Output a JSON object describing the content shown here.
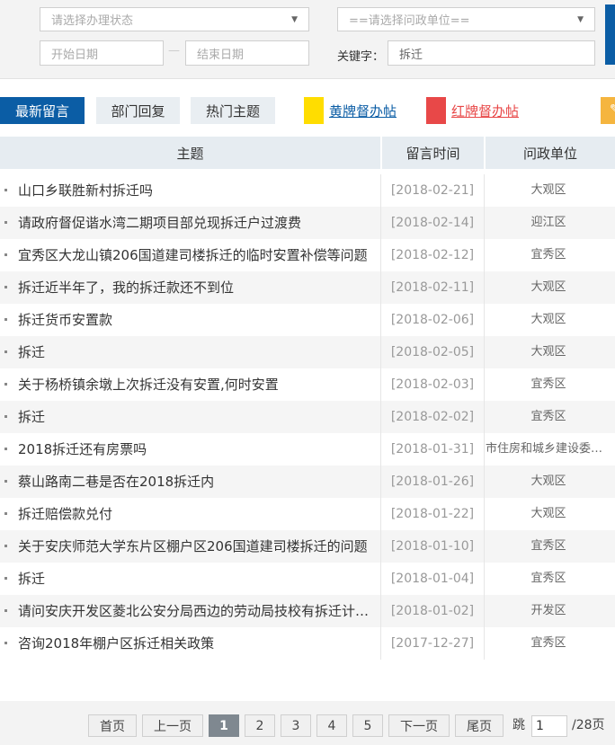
{
  "filters": {
    "status_placeholder": "请选择办理状态",
    "unit_placeholder": "==请选择问政单位==",
    "start_date_placeholder": "开始日期",
    "end_date_placeholder": "结束日期",
    "keyword_label": "关键字：",
    "keyword_value": "拆迁"
  },
  "tabs": {
    "latest": "最新留言",
    "dept_reply": "部门回复",
    "hot_topics": "热门主题",
    "yellow_label": "黄牌督办帖",
    "red_label": "红牌督办帖"
  },
  "colors": {
    "primary": "#0b5da5",
    "yellow_flag": "#ffdd00",
    "red_flag": "#e84848",
    "orange": "#f5b53f"
  },
  "table": {
    "headers": {
      "title": "主题",
      "time": "留言时间",
      "unit": "问政单位"
    },
    "rows": [
      {
        "title": "山口乡联胜新村拆迁吗",
        "date": "[2018-02-21]",
        "unit": "大观区"
      },
      {
        "title": "请政府督促谐水湾二期项目部兑现拆迁户过渡费",
        "date": "[2018-02-14]",
        "unit": "迎江区"
      },
      {
        "title": "宜秀区大龙山镇206国道建司楼拆迁的临时安置补偿等问题",
        "date": "[2018-02-12]",
        "unit": "宜秀区"
      },
      {
        "title": "拆迁近半年了，我的拆迁款还不到位",
        "date": "[2018-02-11]",
        "unit": "大观区"
      },
      {
        "title": "拆迁货币安置款",
        "date": "[2018-02-06]",
        "unit": "大观区"
      },
      {
        "title": "拆迁",
        "date": "[2018-02-05]",
        "unit": "大观区"
      },
      {
        "title": "关于杨桥镇余墩上次拆迁没有安置,何时安置",
        "date": "[2018-02-03]",
        "unit": "宜秀区"
      },
      {
        "title": "拆迁",
        "date": "[2018-02-02]",
        "unit": "宜秀区"
      },
      {
        "title": "2018拆迁还有房票吗",
        "date": "[2018-01-31]",
        "unit": "市住房和城乡建设委员会"
      },
      {
        "title": "蔡山路南二巷是否在2018拆迁内",
        "date": "[2018-01-26]",
        "unit": "大观区"
      },
      {
        "title": "拆迁赔偿款兑付",
        "date": "[2018-01-22]",
        "unit": "大观区"
      },
      {
        "title": "关于安庆师范大学东片区棚户区206国道建司楼拆迁的问题",
        "date": "[2018-01-10]",
        "unit": "宜秀区"
      },
      {
        "title": "拆迁",
        "date": "[2018-01-04]",
        "unit": "宜秀区"
      },
      {
        "title": "请问安庆开发区菱北公安分局西边的劳动局技校有拆迁计划吗",
        "date": "[2018-01-02]",
        "unit": "开发区"
      },
      {
        "title": "咨询2018年棚户区拆迁相关政策",
        "date": "[2017-12-27]",
        "unit": "宜秀区"
      }
    ]
  },
  "pagination": {
    "first": "首页",
    "prev": "上一页",
    "pages": [
      "1",
      "2",
      "3",
      "4",
      "5"
    ],
    "current_page": "1",
    "next": "下一页",
    "last": "尾页",
    "jump_label": "跳",
    "jump_value": "1",
    "total": "/28页"
  }
}
